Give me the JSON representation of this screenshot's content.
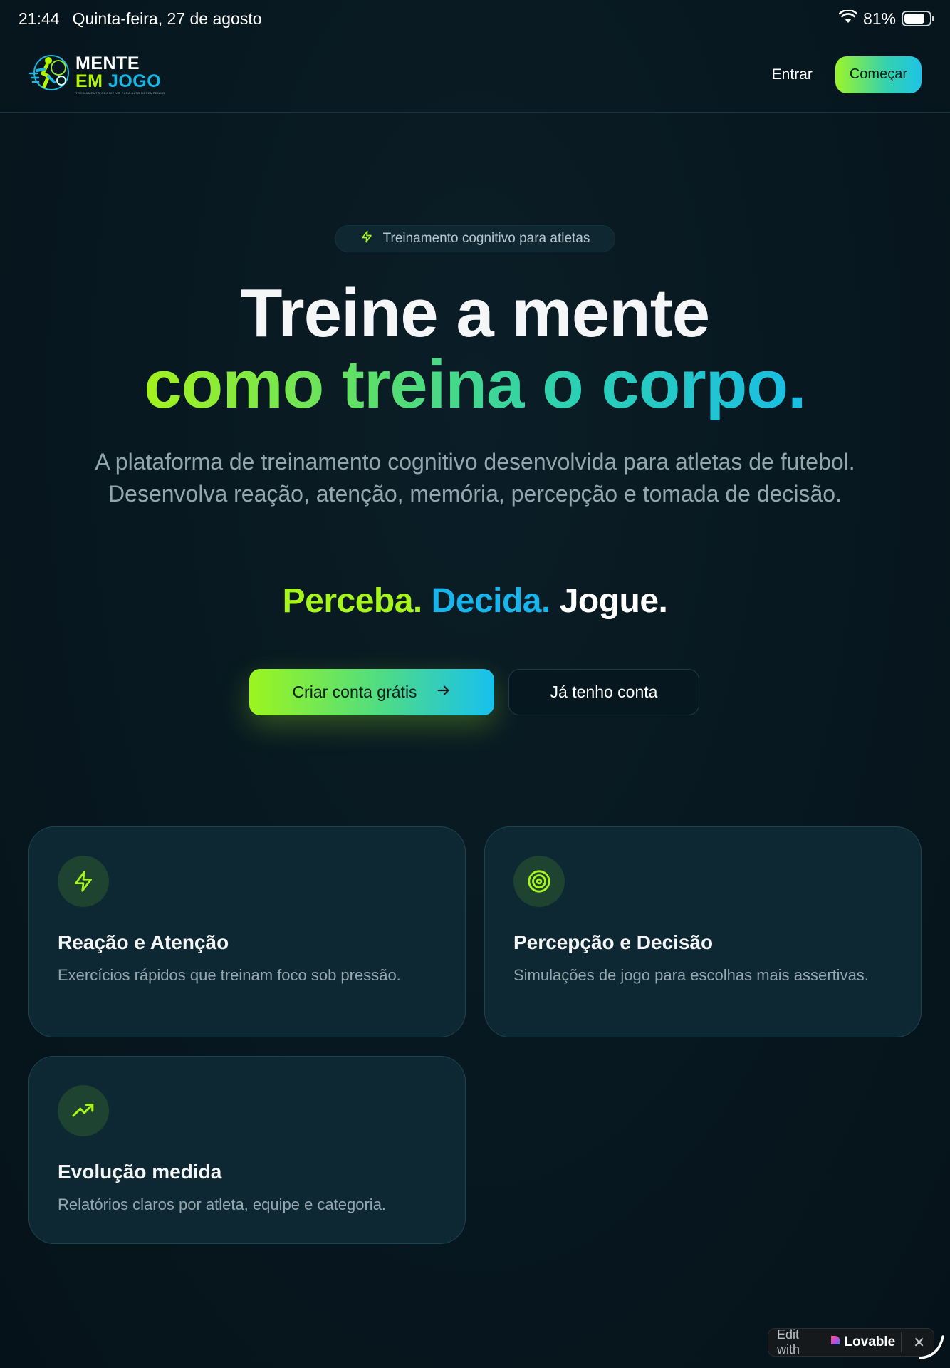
{
  "status_bar": {
    "time": "21:44",
    "date": "Quinta-feira, 27 de agosto",
    "battery": "81%",
    "battery_level": 0.81
  },
  "header": {
    "logo": {
      "line1": "MENTE",
      "line2_a": "EM",
      "line2_b": "JOGO",
      "tagline": "TREINAMENTO COGNITIVO PARA ALTO DESEMPENHO"
    },
    "login_label": "Entrar",
    "start_label": "Começar"
  },
  "hero": {
    "badge": "Treinamento cognitivo para atletas",
    "title_line1": "Treine a mente",
    "title_line2": "como treina o corpo.",
    "description": "A plataforma de treinamento cognitivo desenvolvida para atletas de futebol. Desenvolva reação, atenção, memória, percepção e tomada de decisão.",
    "tagline": {
      "part1": "Perceba.",
      "part2": "Decida.",
      "part3": "Jogue."
    },
    "cta_primary": "Criar conta grátis",
    "cta_secondary": "Já tenho conta"
  },
  "features": [
    {
      "icon": "lightning-icon",
      "title": "Reação e Atenção",
      "text": "Exercícios rápidos que treinam foco sob pressão."
    },
    {
      "icon": "target-icon",
      "title": "Percepção e Decisão",
      "text": "Simulações de jogo para escolhas mais assertivas."
    },
    {
      "icon": "trending-up-icon",
      "title": "Evolução medida",
      "text": "Relatórios claros por atleta, equipe e categoria."
    }
  ],
  "lovable": {
    "edit_with": "Edit with",
    "brand": "Lovable"
  },
  "colors": {
    "background": "#07171f",
    "accent_green": "#a6f51d",
    "accent_cyan": "#17b5ec",
    "card_bg": "#0e2833"
  }
}
